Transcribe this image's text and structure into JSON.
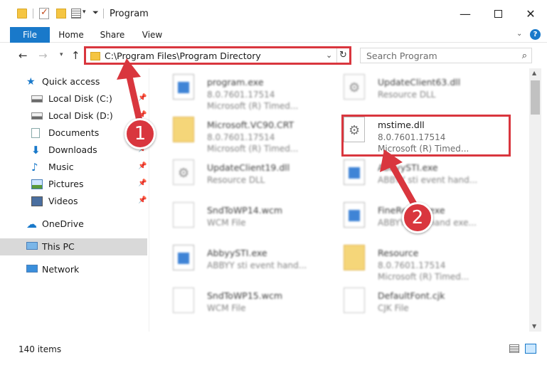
{
  "window": {
    "title": "Program",
    "minimize": "—",
    "close": "✕"
  },
  "ribbon": {
    "tabs": [
      "File",
      "Home",
      "Share",
      "View"
    ],
    "help": "?"
  },
  "nav": {
    "address": "C:\\Program Files\\Program Directory",
    "search_placeholder": "Search Program"
  },
  "sidebar": {
    "items": [
      {
        "label": "Quick access",
        "icon": "star-icon"
      },
      {
        "label": "Local Disk (C:)",
        "icon": "disk-icon"
      },
      {
        "label": "Local Disk (D:)",
        "icon": "disk-icon"
      },
      {
        "label": "Documents",
        "icon": "documents-icon"
      },
      {
        "label": "Downloads",
        "icon": "downloads-icon"
      },
      {
        "label": "Music",
        "icon": "music-icon"
      },
      {
        "label": "Pictures",
        "icon": "pictures-icon"
      },
      {
        "label": "Videos",
        "icon": "videos-icon"
      },
      {
        "label": "OneDrive",
        "icon": "onedrive-icon"
      },
      {
        "label": "This PC",
        "icon": "this-pc-icon"
      },
      {
        "label": "Network",
        "icon": "network-icon"
      }
    ]
  },
  "files": [
    {
      "name": "program.exe",
      "line1": "8.0.7601.17514",
      "line2": "Microsoft (R) Timed..."
    },
    {
      "name": "UpdateClient63.dll",
      "line1": "Resource DLL",
      "line2": ""
    },
    {
      "name": "Microsoft.VC90.CRT",
      "line1": "8.0.7601.17514",
      "line2": "Microsoft (R) Timed..."
    },
    {
      "name": "mstime.dll",
      "line1": "8.0.7601.17514",
      "line2": "Microsoft (R) Timed..."
    },
    {
      "name": "UpdateClient19.dll",
      "line1": "Resource DLL",
      "line2": ""
    },
    {
      "name": "AbbyySTI.exe",
      "line1": "ABBYY sti event hand...",
      "line2": ""
    },
    {
      "name": "SndToWP14.wcm",
      "line1": "WCM File",
      "line2": ""
    },
    {
      "name": "FineReader.exe",
      "line1": "ABBYY command exe...",
      "line2": ""
    },
    {
      "name": "AbbyySTI.exe",
      "line1": "ABBYY sti event hand...",
      "line2": ""
    },
    {
      "name": "Resource",
      "line1": "8.0.7601.17514",
      "line2": "Microsoft (R) Timed..."
    },
    {
      "name": "SndToWP15.wcm",
      "line1": "WCM File",
      "line2": ""
    },
    {
      "name": "DefaultFont.cjk",
      "line1": "CJK File",
      "line2": ""
    }
  ],
  "status": {
    "count": "140 items"
  },
  "annotations": {
    "step1": "1",
    "step2": "2"
  },
  "colors": {
    "accent": "#1979ca",
    "annotation_red": "#d9363e"
  }
}
